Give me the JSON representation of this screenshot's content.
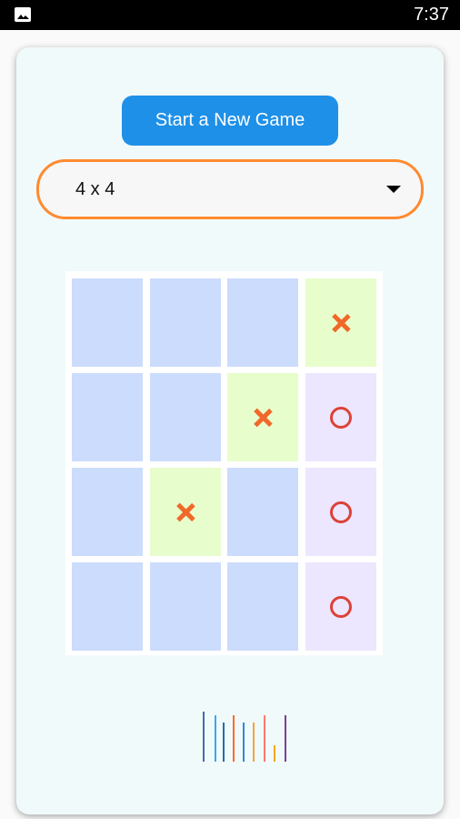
{
  "status_bar": {
    "time": "7:37",
    "notification_icon": "image-icon"
  },
  "controls": {
    "new_game_label": "Start a New Game",
    "board_size_selected": "4 x 4",
    "board_size_icon": "caret-down-icon"
  },
  "board": {
    "size": 4,
    "cells": [
      [
        "",
        "",
        "",
        "X"
      ],
      [
        "",
        "",
        "X",
        "O"
      ],
      [
        "",
        "X",
        "",
        "O"
      ],
      [
        "",
        "",
        "",
        "O"
      ]
    ]
  },
  "colors": {
    "accent_button": "#1e90e8",
    "select_border": "#ff8a30",
    "empty_cell": "#ccdcfd",
    "x_cell": "#e8fdcc",
    "o_cell": "#ece6fe",
    "x_mark": "#f0692a",
    "o_mark": "#dc4238"
  },
  "decor_bars": {
    "relative_heights": [
      1.0,
      0.93,
      0.78,
      0.93,
      0.78,
      0.78,
      0.93,
      0.33,
      0.93
    ],
    "colors": [
      "#4a6aa8",
      "#3aa8ec",
      "#1f6fa8",
      "#ff6a2a",
      "#2f86e0",
      "#f7a23c",
      "#ff7a6a",
      "#f5a623",
      "#7a3f98"
    ]
  }
}
